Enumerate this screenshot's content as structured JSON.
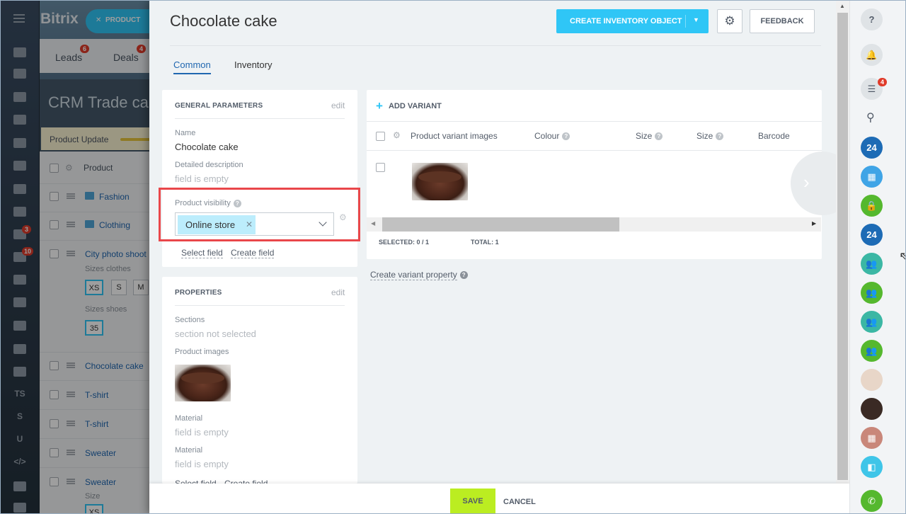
{
  "background": {
    "logo": "Bitrix",
    "product_pill": "PRODUCT",
    "tabs": [
      {
        "label": "Leads",
        "count": "6"
      },
      {
        "label": "Deals",
        "count": "4"
      }
    ],
    "page_title": "CRM Trade ca",
    "update_label": "Product Update",
    "list_header": "Product",
    "rows": [
      {
        "label": "Fashion",
        "type": "folder"
      },
      {
        "label": "Clothing",
        "type": "folder"
      },
      {
        "label": "City photo shoot",
        "type": "item"
      },
      {
        "label": "Chocolate cake",
        "type": "item"
      },
      {
        "label": "T-shirt",
        "type": "item"
      },
      {
        "label": "T-shirt",
        "type": "item"
      },
      {
        "label": "Sweater",
        "type": "item"
      },
      {
        "label": "Sweater",
        "type": "item"
      }
    ],
    "sizes_clothes_label": "Sizes clothes",
    "sizes_clothes": [
      "XS",
      "S",
      "M"
    ],
    "sizes_shoes_label": "Sizes shoes",
    "sizes_shoes": [
      "35"
    ],
    "size_label": "Size",
    "left_nav_badges": {
      "tasks": "3",
      "pipeline": "10"
    },
    "left_nav_texts": [
      "TS",
      "S",
      "U"
    ]
  },
  "panel": {
    "title": "Chocolate cake",
    "create_button": "CREATE INVENTORY OBJECT",
    "feedback_button": "FEEDBACK",
    "tabs": [
      {
        "label": "Common",
        "active": true
      },
      {
        "label": "Inventory",
        "active": false
      }
    ],
    "general": {
      "header": "GENERAL PARAMETERS",
      "edit": "edit",
      "name_label": "Name",
      "name_value": "Chocolate cake",
      "desc_label": "Detailed description",
      "desc_value": "field is empty",
      "visibility_label": "Product visibility",
      "visibility_value": "Online store",
      "select_field": "Select field",
      "create_field": "Create field"
    },
    "properties": {
      "header": "PROPERTIES",
      "edit": "edit",
      "sections_label": "Sections",
      "sections_value": "section not selected",
      "images_label": "Product images",
      "material1_label": "Material",
      "material1_value": "field is empty",
      "material2_label": "Material",
      "material2_value": "field is empty",
      "select_field": "Select field",
      "create_field": "Create field"
    },
    "variants": {
      "add_label": "ADD VARIANT",
      "columns": [
        "Product variant images",
        "Colour",
        "Size",
        "Size",
        "Barcode"
      ],
      "selected": "SELECTED: 0 / 1",
      "total": "TOTAL: 1",
      "create_property": "Create variant property"
    },
    "footer": {
      "save": "SAVE",
      "cancel": "CANCEL"
    }
  },
  "right_bar": {
    "chat_badge": "4",
    "icons": [
      "help-icon",
      "bell-icon",
      "chat-icon",
      "search-icon",
      "bitrix24-icon",
      "calendar-icon",
      "lock-icon",
      "bitrix24-icon",
      "group-icon",
      "group-icon",
      "group-icon",
      "group-icon",
      "user-avatar",
      "user-avatar",
      "calendar-icon",
      "contact-center-icon",
      "phone-icon"
    ],
    "b24_label": "24"
  },
  "colors": {
    "accent": "#2fc6f6",
    "save": "#bbed21",
    "highlight": "#e9474a",
    "link": "#2067b0",
    "green": "#55b82e",
    "teal": "#3bb7a4",
    "blue": "#1d6bb5"
  }
}
